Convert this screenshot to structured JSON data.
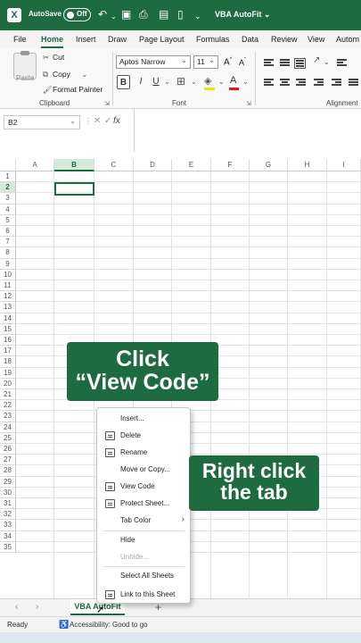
{
  "titlebar": {
    "autosave_label": "AutoSave",
    "autosave_state": "Off",
    "doc_title": "VBA AutoFit ⌄",
    "icons": [
      "excel-logo",
      "undo-icon",
      "redo-icon",
      "save-icon",
      "print-icon",
      "print-preview-icon",
      "customize-icon"
    ]
  },
  "ribbon_tabs": [
    "File",
    "Home",
    "Insert",
    "Draw",
    "Page Layout",
    "Formulas",
    "Data",
    "Review",
    "View",
    "Autom"
  ],
  "ribbon": {
    "clipboard": {
      "paste": "Paste",
      "cut": "Cut",
      "copy": "Copy",
      "format_painter": "Format Painter",
      "group_label": "Clipboard"
    },
    "font": {
      "font_name": "Aptos Narrow",
      "font_size": "11",
      "bold": "B",
      "italic": "I",
      "underline": "U",
      "increase": "A^",
      "decrease": "Aˇ",
      "group_label": "Font"
    },
    "alignment": {
      "group_label": "Alignment"
    }
  },
  "formula_bar": {
    "name_box": "B2",
    "fx": "fx",
    "formula": ""
  },
  "grid": {
    "columns": [
      "A",
      "B",
      "C",
      "D",
      "E",
      "F",
      "G",
      "H",
      "I"
    ],
    "rows": [
      "1",
      "2",
      "3",
      "4",
      "5",
      "6",
      "7",
      "8",
      "9",
      "10",
      "11",
      "12",
      "13",
      "14",
      "15",
      "16",
      "17",
      "18",
      "19",
      "20",
      "21",
      "22",
      "23",
      "24",
      "25",
      "26",
      "27",
      "28",
      "29",
      "30",
      "31",
      "32",
      "33",
      "34",
      "35"
    ],
    "selected_column": "B",
    "selected_row": "2"
  },
  "sheet_tabs": {
    "active": "VBA AutoFit",
    "add": "+"
  },
  "status": {
    "ready": "Ready",
    "accessibility": "Accessibility: Good to go"
  },
  "context_menu": {
    "items": [
      {
        "label": "Insert...",
        "icon": "",
        "disabled": false
      },
      {
        "label": "Delete",
        "icon": "delete-icon",
        "disabled": false
      },
      {
        "label": "Rename",
        "icon": "rename-icon",
        "disabled": false
      },
      {
        "label": "Move or Copy...",
        "icon": "",
        "disabled": false
      },
      {
        "label": "View Code",
        "icon": "view-code-icon",
        "disabled": false
      },
      {
        "label": "Protect Sheet...",
        "icon": "protect-sheet-icon",
        "disabled": false
      },
      {
        "label": "Tab Color",
        "icon": "",
        "disabled": false
      },
      {
        "label": "Hide",
        "icon": "",
        "disabled": false
      },
      {
        "label": "Unhide...",
        "icon": "",
        "disabled": true
      },
      {
        "label": "Select All Sheets",
        "icon": "",
        "disabled": false
      },
      {
        "label": "Link to this Sheet",
        "icon": "link-icon",
        "disabled": false
      }
    ]
  },
  "captions": {
    "click_line1": "Click",
    "click_line2": "“View Code”",
    "right_line1": "Right click",
    "right_line2": "the tab"
  },
  "colors": {
    "accent": "#1e6b40",
    "grid_line": "#e3e3e3"
  }
}
